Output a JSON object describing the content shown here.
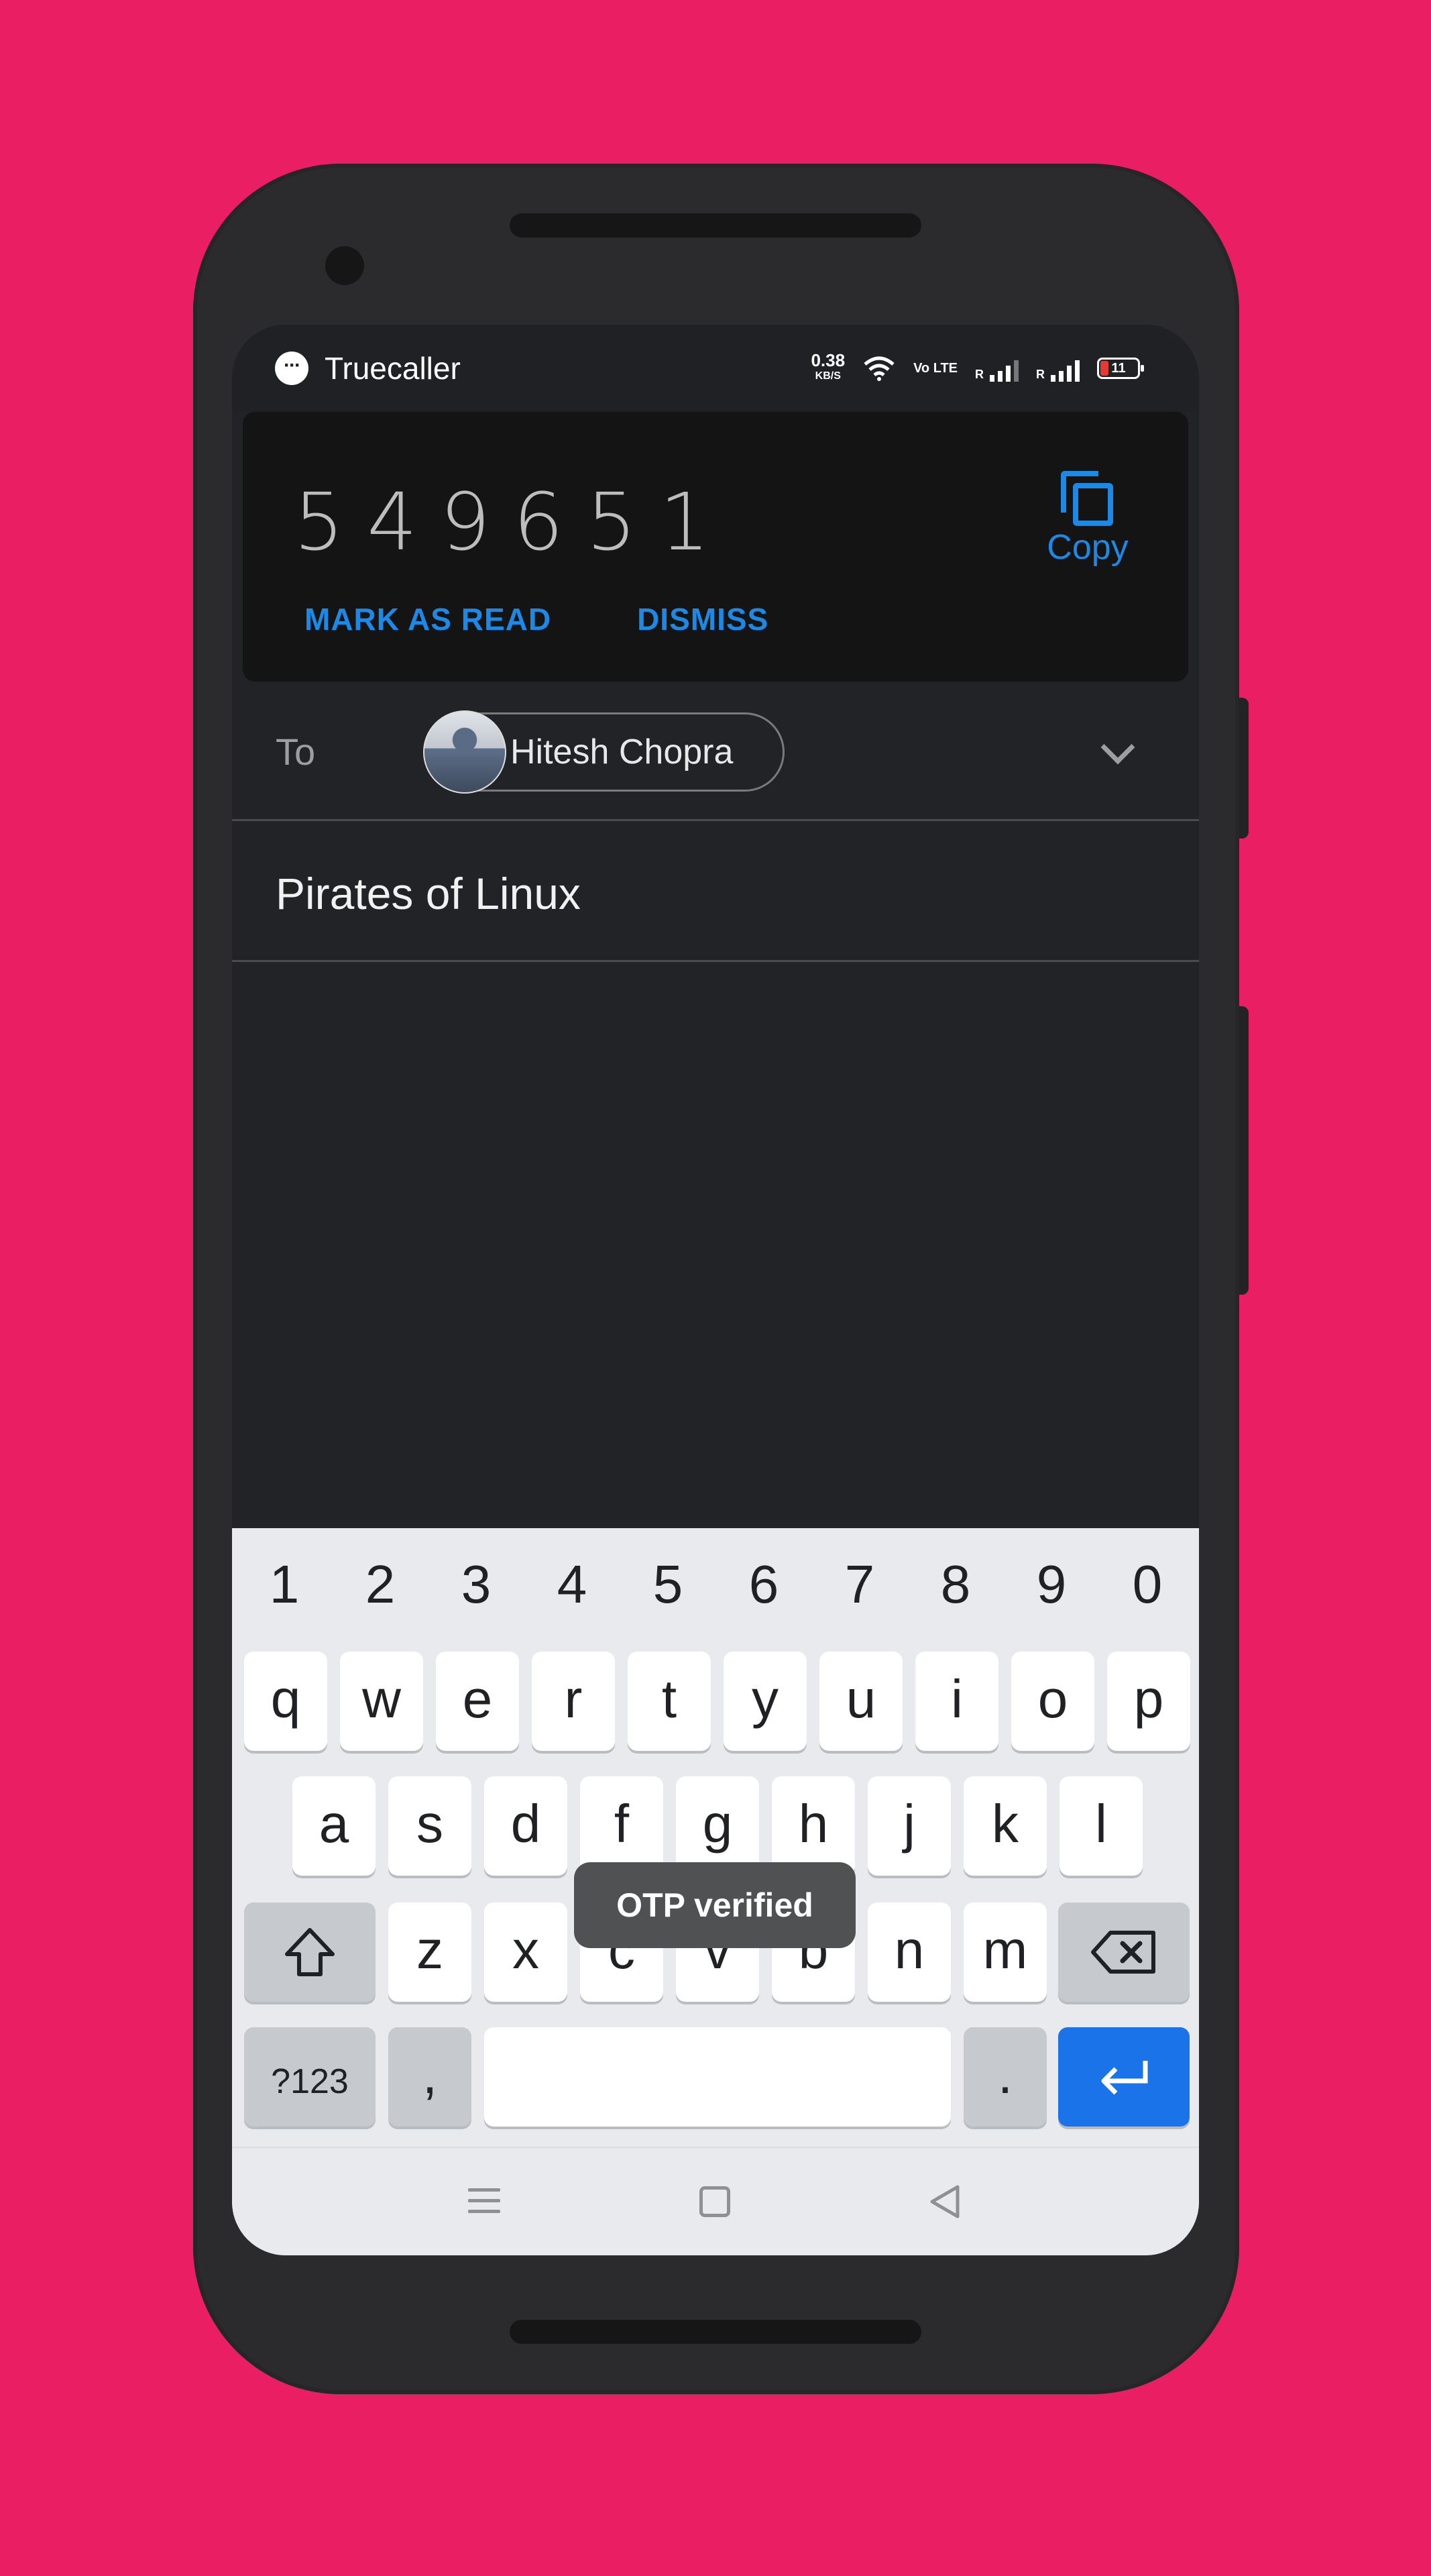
{
  "status_bar": {
    "app_name": "Truecaller",
    "speed_value": "0.38",
    "speed_unit": "KB/S",
    "volte": "Vo LTE",
    "signal_label_1": "R",
    "signal_label_2": "R",
    "battery": "11"
  },
  "otp_card": {
    "code": "549651",
    "copy_label": "Copy",
    "mark_as_read_label": "MARK AS READ",
    "dismiss_label": "DISMISS"
  },
  "compose": {
    "to_label": "To",
    "recipient_name": "Hitesh Chopra",
    "subject": "Pirates of Linux"
  },
  "keyboard": {
    "number_row": [
      "1",
      "2",
      "3",
      "4",
      "5",
      "6",
      "7",
      "8",
      "9",
      "0"
    ],
    "row1": [
      "q",
      "w",
      "e",
      "r",
      "t",
      "y",
      "u",
      "i",
      "o",
      "p"
    ],
    "row2": [
      "a",
      "s",
      "d",
      "f",
      "g",
      "h",
      "j",
      "k",
      "l"
    ],
    "row3": [
      "z",
      "x",
      "c",
      "v",
      "b",
      "n",
      "m"
    ],
    "symbols_label": "?123",
    "comma_label": ",",
    "period_label": "."
  },
  "toast": {
    "message": "OTP verified"
  },
  "colors": {
    "background": "#e91e63",
    "accent": "#1e88e5",
    "enter_key": "#1a73e8"
  },
  "icons": {
    "copy": "copy-icon",
    "chevron": "chevron-down-icon",
    "shift": "shift-icon",
    "backspace": "backspace-icon",
    "enter": "enter-icon",
    "nav_recent": "menu-icon",
    "nav_home": "home-icon",
    "nav_back": "back-icon"
  }
}
